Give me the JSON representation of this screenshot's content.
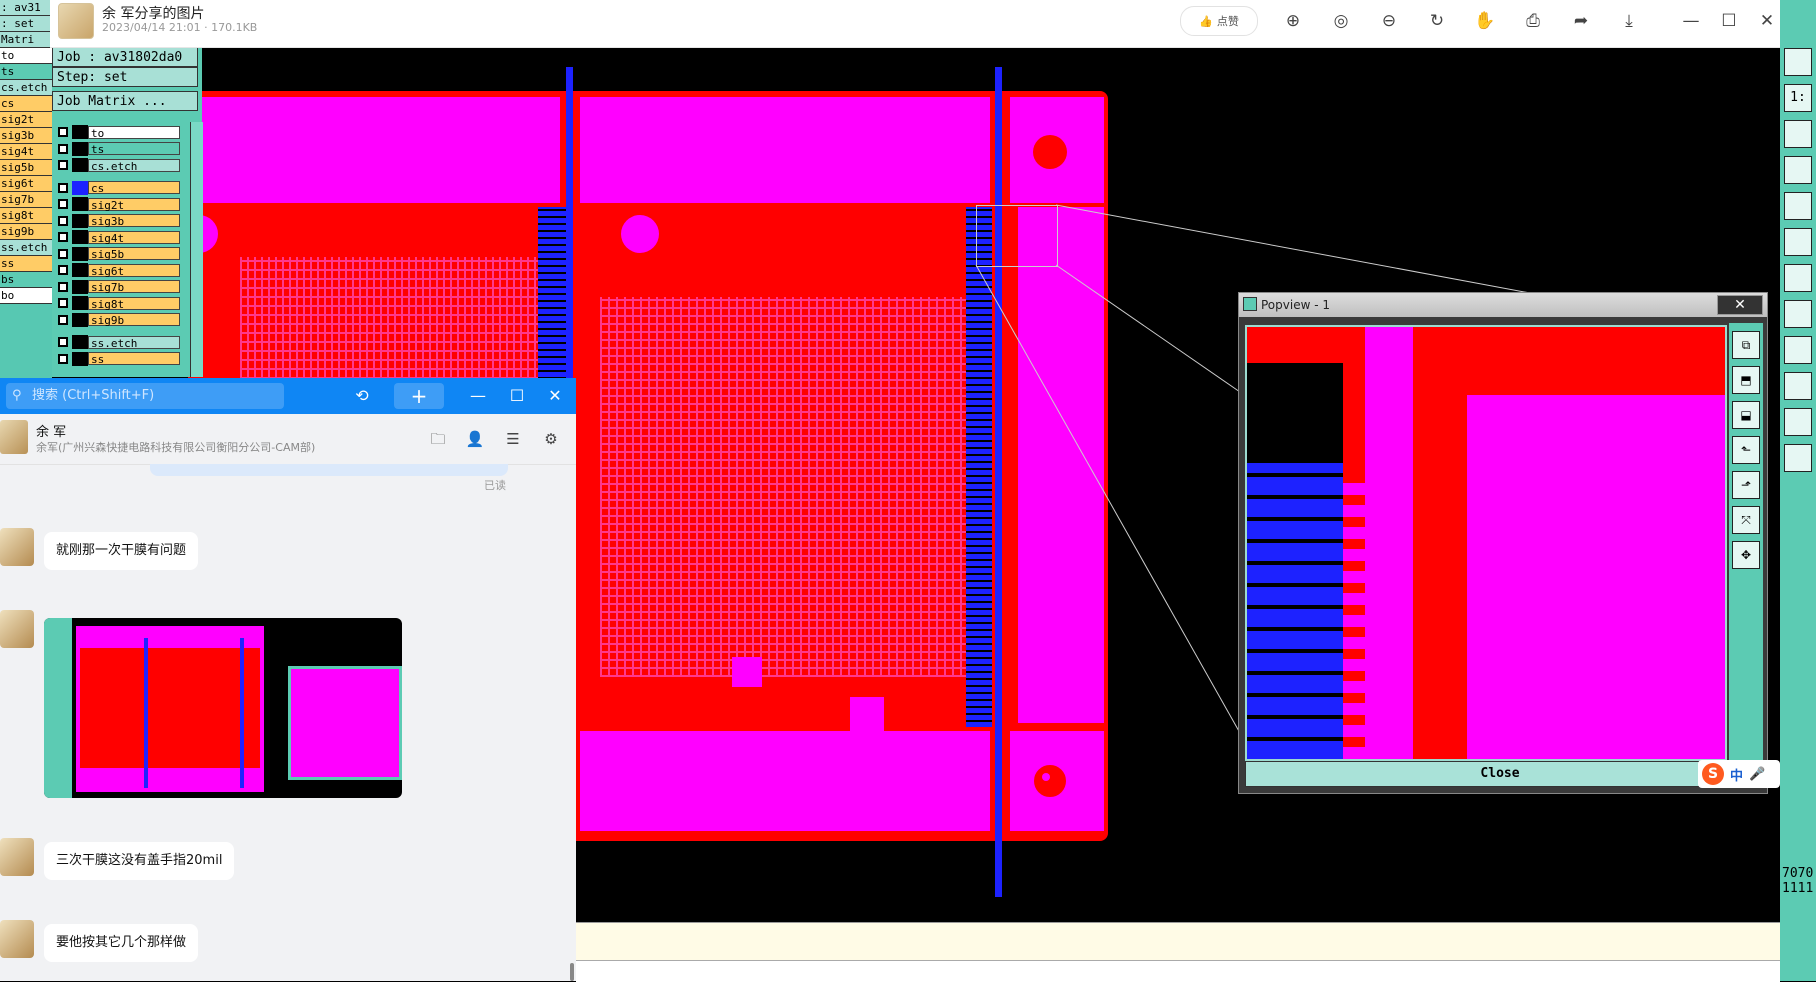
{
  "viewer": {
    "title": "余  军分享的图片",
    "subtitle": "2023/04/14 21:01 · 170.1KB",
    "like_label": "点赞",
    "toolbar_icons": [
      "zoom-in-icon",
      "original-size-icon",
      "zoom-out-icon",
      "rotate-icon",
      "hand-icon",
      "print-icon",
      "share-icon",
      "download-icon"
    ],
    "window_icons": [
      "minimize-icon",
      "maximize-icon",
      "close-icon"
    ]
  },
  "left_cam": {
    "rows": [
      {
        "label": ": av31",
        "color": "#a8e0d6"
      },
      {
        "label": ": set",
        "color": "#a8e0d6"
      },
      {
        "label": "Matri",
        "color": "#a8e0d6"
      },
      {
        "label": "to",
        "color": "#ffffff"
      },
      {
        "label": "ts",
        "color": "#5ccbb3"
      },
      {
        "label": "cs.etch",
        "color": "#a8e0d6"
      },
      {
        "label": "cs",
        "color": "#ffcc66"
      },
      {
        "label": "sig2t",
        "color": "#ffcc66"
      },
      {
        "label": "sig3b",
        "color": "#ffcc66"
      },
      {
        "label": "sig4t",
        "color": "#ffcc66"
      },
      {
        "label": "sig5b",
        "color": "#ffcc66"
      },
      {
        "label": "sig6t",
        "color": "#ffcc66"
      },
      {
        "label": "sig7b",
        "color": "#ffcc66"
      },
      {
        "label": "sig8t",
        "color": "#ffcc66"
      },
      {
        "label": "sig9b",
        "color": "#ffcc66"
      },
      {
        "label": "ss.etch",
        "color": "#a8e0d6"
      },
      {
        "label": "ss",
        "color": "#ffcc66"
      },
      {
        "label": "bs",
        "color": "#5ccbb3"
      },
      {
        "label": "bo",
        "color": "#ffffff"
      }
    ]
  },
  "cam": {
    "job": "Job : av31802da0",
    "step": "Step: set",
    "matrix_button": "Job Matrix ...",
    "layers": [
      {
        "name": "to",
        "color": "#ffffff"
      },
      {
        "name": "ts",
        "color": "#5ccbb3"
      },
      {
        "name": "cs.etch",
        "color": "#a8e0d6"
      },
      {
        "name": "cs",
        "color": "#ffcc66"
      },
      {
        "name": "sig2t",
        "color": "#ffcc66"
      },
      {
        "name": "sig3b",
        "color": "#ffcc66"
      },
      {
        "name": "sig4t",
        "color": "#ffcc66"
      },
      {
        "name": "sig5b",
        "color": "#ffcc66"
      },
      {
        "name": "sig6t",
        "color": "#ffcc66"
      },
      {
        "name": "sig7b",
        "color": "#ffcc66"
      },
      {
        "name": "sig8t",
        "color": "#ffcc66"
      },
      {
        "name": "sig9b",
        "color": "#ffcc66"
      },
      {
        "name": "ss.etch",
        "color": "#a8e0d6"
      },
      {
        "name": "ss",
        "color": "#ffcc66"
      }
    ]
  },
  "popview": {
    "title": "Popview - 1",
    "close_label": "Close"
  },
  "chat": {
    "search_placeholder": "搜索 (Ctrl+Shift+F)",
    "contact_name": "余  军",
    "contact_org": "余军(广州兴森快捷电路科技有限公司衡阳分公司-CAM部)",
    "read_label": "已读",
    "messages": [
      {
        "text": "就刚那一次干膜有问题"
      },
      {
        "text": "三次干膜这没有盖手指20mil"
      },
      {
        "text": "要他按其它几个那样做"
      }
    ]
  },
  "right_tools": {
    "labels": [
      "",
      "1:",
      "",
      "",
      "",
      "",
      "",
      "",
      "",
      "",
      "",
      ""
    ],
    "right_edge_digits": [
      "7070",
      "1111"
    ]
  },
  "ime": {
    "label": "中"
  },
  "colors": {
    "magenta": "#ff00ff",
    "red": "#ff0000",
    "blue": "#1d22ff",
    "teal": "#5ccbb3",
    "chat_blue": "#0f86f4"
  }
}
